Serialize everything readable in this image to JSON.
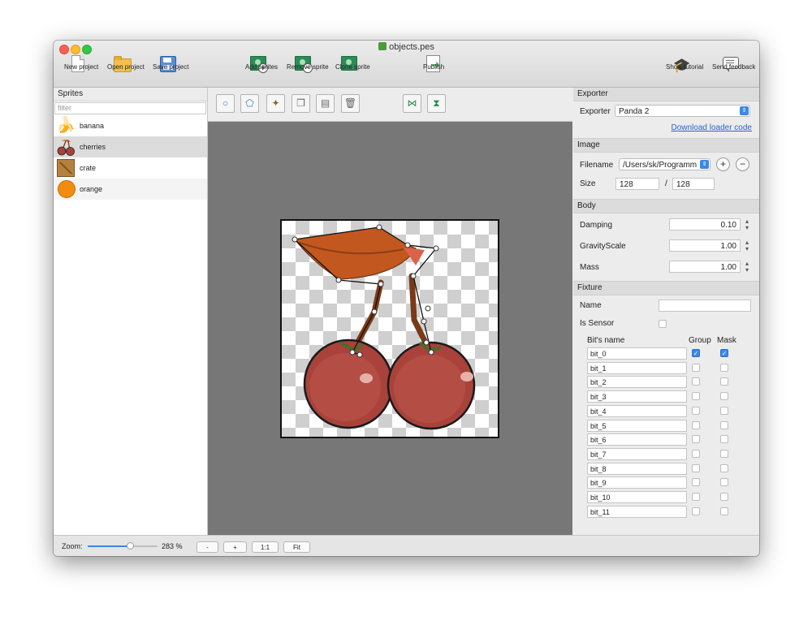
{
  "window": {
    "title": "objects.pes"
  },
  "toolbar": {
    "new_project": "New project",
    "open_project": "Open project",
    "save_project": "Save project",
    "add_sprites": "Add sprites",
    "remove_sprite": "Remove sprite",
    "clone_sprite": "Clone sprite",
    "publish": "Publish",
    "show_tutorial": "Show tutorial",
    "send_feedback": "Send feedback"
  },
  "sprites": {
    "header": "Sprites",
    "filter_placeholder": "filter",
    "items": [
      {
        "label": "banana",
        "icon": "banana-icon"
      },
      {
        "label": "cherries",
        "icon": "cherries-icon"
      },
      {
        "label": "crate",
        "icon": "crate-icon"
      },
      {
        "label": "orange",
        "icon": "orange-icon"
      }
    ],
    "selected": "cherries"
  },
  "editor_tools": [
    "circle-tool",
    "polygon-tool",
    "magic-wand-tool",
    "copy-tool",
    "paste-tool",
    "delete-tool",
    "flip-horizontal-tool",
    "flip-vertical-tool"
  ],
  "exporter": {
    "header": "Exporter",
    "label": "Exporter",
    "value": "Panda 2",
    "download_link": "Download loader code"
  },
  "image": {
    "header": "Image",
    "filename_label": "Filename",
    "filename_value": "/Users/sk/Programm",
    "size_label": "Size",
    "width": "128",
    "separator": "/",
    "height": "128"
  },
  "body": {
    "header": "Body",
    "damping_label": "Damping",
    "damping": "0.10",
    "gravity_label": "GravityScale",
    "gravity": "1.00",
    "mass_label": "Mass",
    "mass": "1.00"
  },
  "fixture": {
    "header": "Fixture",
    "name_label": "Name",
    "name_value": "",
    "sensor_label": "Is Sensor",
    "bits_col": "Bit's name",
    "group_col": "Group",
    "mask_col": "Mask",
    "bits": [
      {
        "name": "bit_0",
        "group": true,
        "mask": true
      },
      {
        "name": "bit_1",
        "group": false,
        "mask": false
      },
      {
        "name": "bit_2",
        "group": false,
        "mask": false
      },
      {
        "name": "bit_3",
        "group": false,
        "mask": false
      },
      {
        "name": "bit_4",
        "group": false,
        "mask": false
      },
      {
        "name": "bit_5",
        "group": false,
        "mask": false
      },
      {
        "name": "bit_6",
        "group": false,
        "mask": false
      },
      {
        "name": "bit_7",
        "group": false,
        "mask": false
      },
      {
        "name": "bit_8",
        "group": false,
        "mask": false
      },
      {
        "name": "bit_9",
        "group": false,
        "mask": false
      },
      {
        "name": "bit_10",
        "group": false,
        "mask": false
      },
      {
        "name": "bit_11",
        "group": false,
        "mask": false
      }
    ]
  },
  "zoom": {
    "label": "Zoom:",
    "value": "283 %",
    "slider_fraction": 0.6,
    "minus": "-",
    "plus": "+",
    "one_to_one": "1:1",
    "fit": "Fit"
  },
  "colors": {
    "accent": "#3b88e8",
    "canvas_bg": "#777777",
    "cherry": "#a9423b"
  }
}
